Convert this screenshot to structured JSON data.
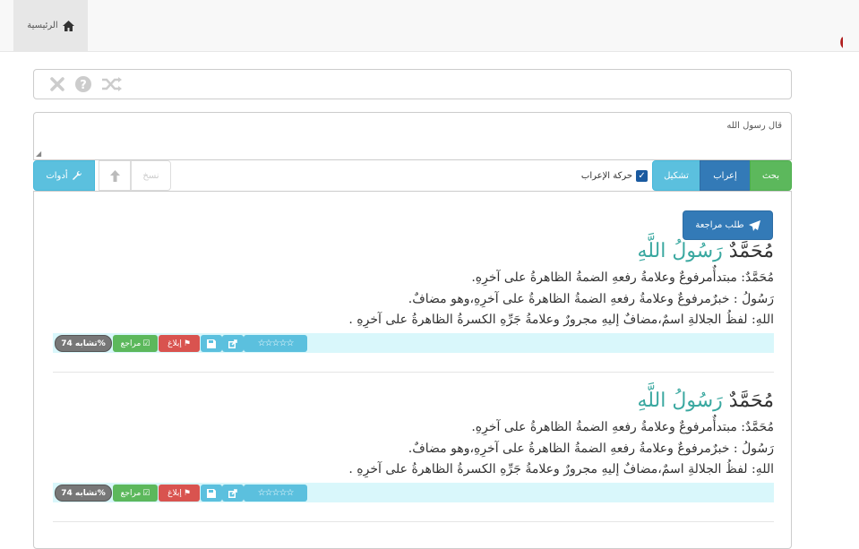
{
  "nav": {
    "home_label": "الرئيسية",
    "logo_text": "يعرُب"
  },
  "toolbar_top": {
    "icons": [
      "times-icon",
      "question-circle-icon",
      "random-icon"
    ]
  },
  "input": {
    "text": "قال رسول الله"
  },
  "buttons": {
    "tools": "أدوات",
    "copy": "نسخ",
    "harakat": "حركة الإعراب",
    "tashkeel": "تشكيل",
    "iraab": "إعراب",
    "search": "بحث",
    "review": "طلب مراجعة"
  },
  "results": [
    {
      "head_w1": "مُحَمَّدٌ ",
      "head_w2": "رَسُولُ اللَّهِ",
      "line1": "مُحَمَّدٌ: مبتدأٌمرفوعٌ وعلامةُ رفعهِ الضمةُ الظاهرةُ على آخرِهِ.",
      "line2": "رَسُولُ : خبرٌمرفوعٌ وعلامةُ رفعهِ الضمةُ الظاهرةُ على آخرِهِ،وهو مضافٌ.",
      "line3": "اللهِ: لفظُ الجلالةِ اسمٌ،مضافٌ إليهِ مجرورٌ وعلامةُ جَرِّهِ الكسرةُ الظاهرةُ على آخرِهِ .",
      "similarity": "تشابه 74%",
      "review": "مراجع",
      "report": "إبلاغ",
      "stars": "☆☆☆☆☆"
    },
    {
      "head_w1": "مُحَمَّدٌ ",
      "head_w2": "رَسُولُ اللَّهِ",
      "line1": "مُحَمَّدٌ: مبتدأٌمرفوعٌ وعلامةُ رفعهِ الضمةُ الظاهرةُ على آخرِهِ.",
      "line2": "رَسُولُ : خبرٌمرفوعٌ وعلامةُ رفعهِ الضمةُ الظاهرةُ على آخرِهِ،وهو مضافٌ.",
      "line3": "اللهِ: لفظُ الجلالةِ اسمٌ،مضافٌ إليهِ مجرورٌ وعلامةُ جَرِّهِ الكسرةُ الظاهرةُ على آخرِهِ .",
      "similarity": "تشابه 74%",
      "review": "مراجع",
      "report": "إبلاغ",
      "stars": "☆☆☆☆☆"
    }
  ],
  "colors": {
    "primary": "#337ab7",
    "info": "#5bc0de",
    "success": "#5cb85c",
    "danger": "#d9534f",
    "logo": "#b01c1c"
  }
}
